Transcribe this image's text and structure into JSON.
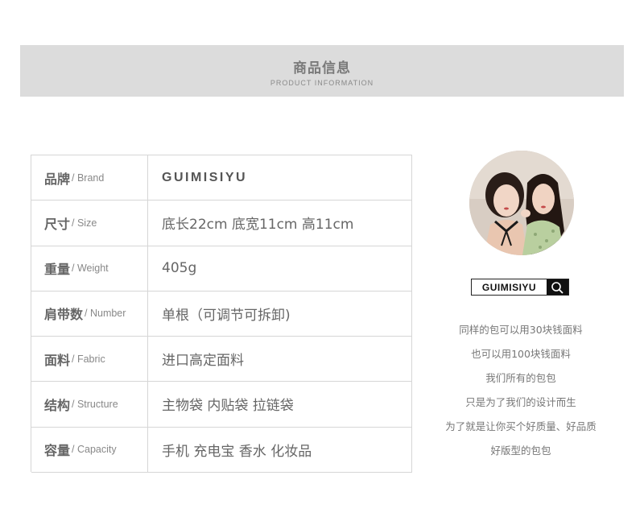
{
  "header": {
    "title": "商品信息",
    "subtitle": "PRODUCT INFORMATION"
  },
  "specs": [
    {
      "label_zh": "品牌",
      "label_en": "/ Brand",
      "value": "GUIMISIYU"
    },
    {
      "label_zh": "尺寸",
      "label_en": "/ Size",
      "value": "底长22cm 底宽11cm 高11cm"
    },
    {
      "label_zh": "重量",
      "label_en": "/ Weight",
      "value": "405g"
    },
    {
      "label_zh": "肩带数",
      "label_en": "/ Number",
      "value": "单根（可调节可拆卸)"
    },
    {
      "label_zh": "面料",
      "label_en": "/ Fabric",
      "value": "进口高定面料"
    },
    {
      "label_zh": "结构",
      "label_en": "/ Structure",
      "value": "主物袋 内贴袋 拉链袋"
    },
    {
      "label_zh": "容量",
      "label_en": "/ Capacity",
      "value": "手机 充电宝 香水 化妆品"
    }
  ],
  "brand_logo": {
    "text": "GUIMISIYU",
    "icon": "search-icon"
  },
  "slogan": [
    "同样的包可以用30块钱面料",
    "也可以用100块钱面料",
    "我们所有的包包",
    "只是为了我们的设计而生",
    "为了就是让你买个好质量、好品质",
    "好版型的包包"
  ],
  "colors": {
    "header_band": "#dcdcdc",
    "table_border": "#d6d6d6",
    "text": "#666666"
  }
}
